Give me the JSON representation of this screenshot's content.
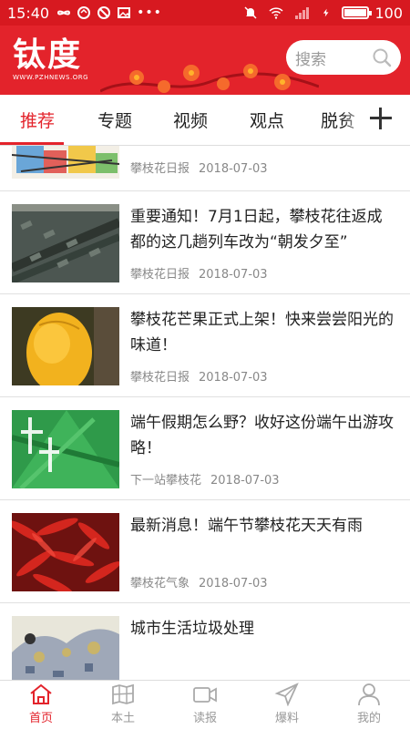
{
  "status_bar": {
    "time": "15:40",
    "battery": "100",
    "battery_level": 1.0
  },
  "header": {
    "logo_text": "钛度",
    "logo_url": "WWW.PZHNEWS.ORG",
    "search_placeholder": "搜索",
    "brand_color": "#e3232b"
  },
  "tabs": [
    {
      "label": "推荐",
      "active": true
    },
    {
      "label": "专题",
      "active": false
    },
    {
      "label": "视频",
      "active": false
    },
    {
      "label": "观点",
      "active": false
    },
    {
      "label": "脱贫",
      "active": false
    }
  ],
  "feed": [
    {
      "title": "",
      "source": "攀枝花日报",
      "date": "2018-07-03",
      "thumb": "cartoon"
    },
    {
      "title": "重要通知！7月1日起，攀枝花往返成都的这几趟列车改为“朝发夕至”",
      "source": "攀枝花日报",
      "date": "2018-07-03",
      "thumb": "train"
    },
    {
      "title": "攀枝花芒果正式上架！快来尝尝阳光的味道！",
      "source": "攀枝花日报",
      "date": "2018-07-03",
      "thumb": "mango"
    },
    {
      "title": "端午假期怎么野？收好这份端午出游攻略！",
      "source": "下一站攀枝花",
      "date": "2018-07-03",
      "thumb": "dragon-boat"
    },
    {
      "title": "最新消息！端午节攀枝花天天有雨",
      "source": "攀枝花气象",
      "date": "2018-07-03",
      "thumb": "peppers"
    },
    {
      "title": "城市生活垃圾处理",
      "source": "",
      "date": "",
      "thumb": "garbage"
    }
  ],
  "bottom_nav": [
    {
      "label": "首页",
      "icon": "home-icon",
      "active": true
    },
    {
      "label": "本土",
      "icon": "map-icon",
      "active": false
    },
    {
      "label": "读报",
      "icon": "video-icon",
      "active": false
    },
    {
      "label": "爆料",
      "icon": "send-icon",
      "active": false
    },
    {
      "label": "我的",
      "icon": "user-icon",
      "active": false
    }
  ]
}
